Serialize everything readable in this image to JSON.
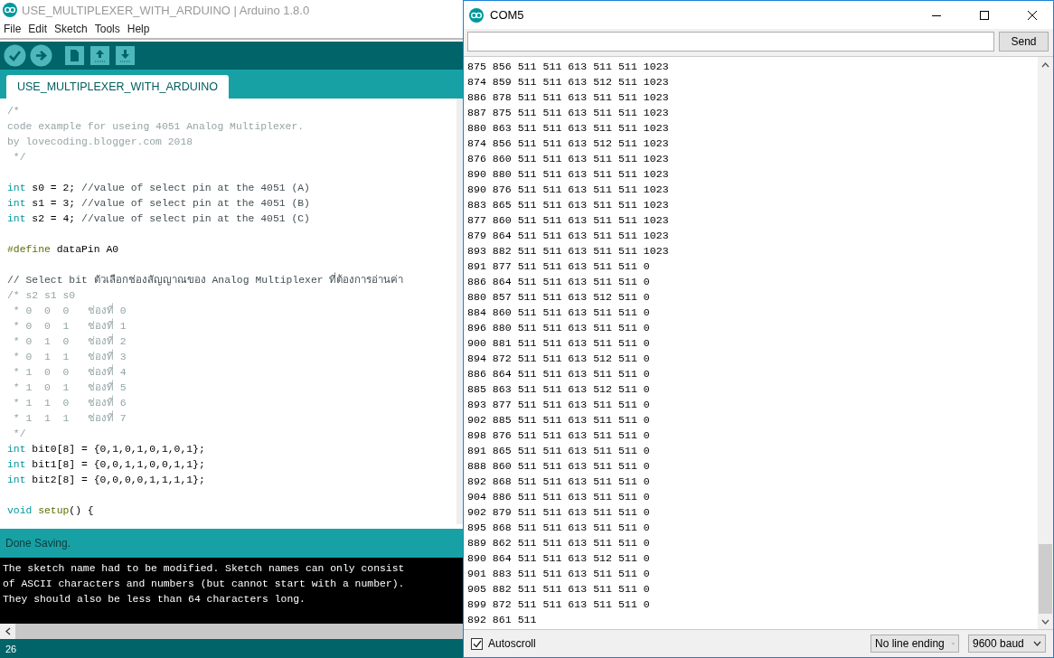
{
  "ide": {
    "title": "USE_MULTIPLEXER_WITH_ARDUINO | Arduino 1.8.0",
    "menu": [
      "File",
      "Edit",
      "Sketch",
      "Tools",
      "Help"
    ],
    "tabs": [
      {
        "label": "USE_MULTIPLEXER_WITH_ARDUINO",
        "selected": true
      }
    ],
    "code": [
      {
        "kind": "text",
        "segments": [
          {
            "text": "/*",
            "kind": "block_comment"
          }
        ]
      },
      {
        "kind": "text",
        "segments": [
          {
            "text": "code example for useing 4051 Analog Multiplexer.",
            "kind": "block_comment"
          }
        ]
      },
      {
        "kind": "text",
        "segments": [
          {
            "text": "by lovecoding.blogger.com 2018",
            "kind": "block_comment"
          }
        ]
      },
      {
        "kind": "text",
        "segments": [
          {
            "text": " */",
            "kind": "block_comment"
          }
        ]
      },
      {
        "kind": "blank"
      },
      {
        "kind": "text",
        "segments": [
          {
            "text": "int",
            "kind": "keyword"
          },
          {
            "text": " s0 = 2; ",
            "kind": "plain"
          },
          {
            "text": "//value of select pin at the 4051 (A)",
            "kind": "line_comment"
          }
        ]
      },
      {
        "kind": "text",
        "segments": [
          {
            "text": "int",
            "kind": "keyword"
          },
          {
            "text": " s1 = 3; ",
            "kind": "plain"
          },
          {
            "text": "//value of select pin at the 4051 (B)",
            "kind": "line_comment"
          }
        ]
      },
      {
        "kind": "text",
        "segments": [
          {
            "text": "int",
            "kind": "keyword"
          },
          {
            "text": " s2 = 4; ",
            "kind": "plain"
          },
          {
            "text": "//value of select pin at the 4051 (C)",
            "kind": "line_comment"
          }
        ]
      },
      {
        "kind": "blank"
      },
      {
        "kind": "text",
        "segments": [
          {
            "text": "#define",
            "kind": "preproc"
          },
          {
            "text": " dataPin A0",
            "kind": "plain"
          }
        ]
      },
      {
        "kind": "blank"
      },
      {
        "kind": "text",
        "segments": [
          {
            "text": "// Select bit ตัวเลือกช่องสัญญาณของ Analog Multiplexer ที่ต้องการอ่านค่า",
            "kind": "line_comment"
          }
        ]
      },
      {
        "kind": "text",
        "segments": [
          {
            "text": "/* s2 s1 s0",
            "kind": "block_comment"
          }
        ]
      },
      {
        "kind": "text",
        "segments": [
          {
            "text": " * 0  0  0   ช่องที่ 0",
            "kind": "block_comment"
          }
        ]
      },
      {
        "kind": "text",
        "segments": [
          {
            "text": " * 0  0  1   ช่องที่ 1",
            "kind": "block_comment"
          }
        ]
      },
      {
        "kind": "text",
        "segments": [
          {
            "text": " * 0  1  0   ช่องที่ 2",
            "kind": "block_comment"
          }
        ]
      },
      {
        "kind": "text",
        "segments": [
          {
            "text": " * 0  1  1   ช่องที่ 3",
            "kind": "block_comment"
          }
        ]
      },
      {
        "kind": "text",
        "segments": [
          {
            "text": " * 1  0  0   ช่องที่ 4",
            "kind": "block_comment"
          }
        ]
      },
      {
        "kind": "text",
        "segments": [
          {
            "text": " * 1  0  1   ช่องที่ 5",
            "kind": "block_comment"
          }
        ]
      },
      {
        "kind": "text",
        "segments": [
          {
            "text": " * 1  1  0   ช่องที่ 6",
            "kind": "block_comment"
          }
        ]
      },
      {
        "kind": "text",
        "segments": [
          {
            "text": " * 1  1  1   ช่องที่ 7",
            "kind": "block_comment"
          }
        ]
      },
      {
        "kind": "text",
        "segments": [
          {
            "text": " */",
            "kind": "block_comment"
          }
        ]
      },
      {
        "kind": "text",
        "segments": [
          {
            "text": "int",
            "kind": "keyword"
          },
          {
            "text": " bit0[8] = {0,1,0,1,0,1,0,1};",
            "kind": "plain"
          }
        ]
      },
      {
        "kind": "text",
        "segments": [
          {
            "text": "int",
            "kind": "keyword"
          },
          {
            "text": " bit1[8] = {0,0,1,1,0,0,1,1};",
            "kind": "plain"
          }
        ]
      },
      {
        "kind": "text",
        "segments": [
          {
            "text": "int",
            "kind": "keyword"
          },
          {
            "text": " bit2[8] = {0,0,0,0,1,1,1,1};",
            "kind": "plain"
          }
        ]
      },
      {
        "kind": "blank"
      },
      {
        "kind": "text",
        "segments": [
          {
            "text": "void",
            "kind": "keyword"
          },
          {
            "text": " setup",
            "kind": "function"
          },
          {
            "text": "() {",
            "kind": "plain"
          }
        ]
      }
    ],
    "status": "Done Saving.",
    "console": [
      "The sketch name had to be modified. Sketch names can only consist",
      "of ASCII characters and numbers (but cannot start with a number).",
      "They should also be less than 64 characters long."
    ],
    "line_number": "26"
  },
  "serial_monitor": {
    "title": "COM5",
    "send_button": "Send",
    "output": [
      "875 856 511 511 613 511 511 1023",
      "874 859 511 511 613 512 511 1023",
      "886 878 511 511 613 511 511 1023",
      "887 875 511 511 613 511 511 1023",
      "880 863 511 511 613 511 511 1023",
      "874 856 511 511 613 512 511 1023",
      "876 860 511 511 613 511 511 1023",
      "890 880 511 511 613 511 511 1023",
      "890 876 511 511 613 511 511 1023",
      "883 865 511 511 613 511 511 1023",
      "877 860 511 511 613 511 511 1023",
      "879 864 511 511 613 511 511 1023",
      "893 882 511 511 613 511 511 1023",
      "891 877 511 511 613 511 511 0",
      "886 864 511 511 613 511 511 0",
      "880 857 511 511 613 512 511 0",
      "884 860 511 511 613 511 511 0",
      "896 880 511 511 613 511 511 0",
      "900 881 511 511 613 511 511 0",
      "894 872 511 511 613 512 511 0",
      "886 864 511 511 613 511 511 0",
      "885 863 511 511 613 512 511 0",
      "893 877 511 511 613 511 511 0",
      "902 885 511 511 613 511 511 0",
      "898 876 511 511 613 511 511 0",
      "891 865 511 511 613 511 511 0",
      "888 860 511 511 613 511 511 0",
      "892 868 511 511 613 511 511 0",
      "904 886 511 511 613 511 511 0",
      "902 879 511 511 613 511 511 0",
      "895 868 511 511 613 511 511 0",
      "889 862 511 511 613 511 511 0",
      "890 864 511 511 613 512 511 0",
      "901 883 511 511 613 511 511 0",
      "905 882 511 511 613 511 511 0",
      "899 872 511 511 613 511 511 0",
      "892 861 511"
    ],
    "autoscroll": {
      "label": "Autoscroll",
      "checked": true
    },
    "line_ending": "No line ending",
    "baud_rate": "9600 baud"
  }
}
